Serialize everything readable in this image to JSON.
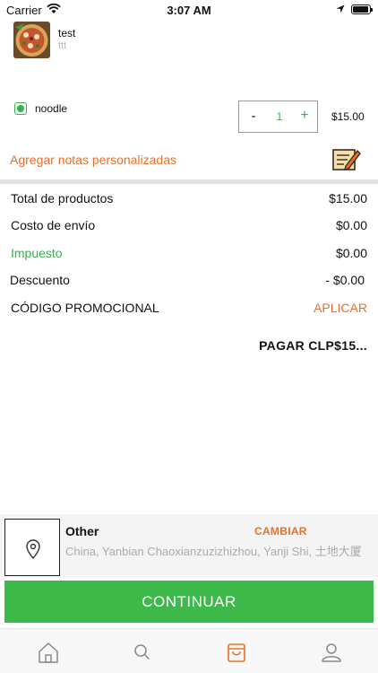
{
  "status_bar": {
    "carrier": "Carrier",
    "time": "3:07 AM"
  },
  "product": {
    "name": "test",
    "description": "ttt",
    "image_icon": "pizza-image"
  },
  "option": {
    "label": "noodle",
    "selected": true
  },
  "stepper": {
    "minus": "-",
    "value": "1",
    "plus": "+"
  },
  "line_price": "$15.00",
  "notes_link": "Agregar notas personalizadas",
  "summary": {
    "subtotal_label": "Total de productos",
    "subtotal_value": "$15.00",
    "shipping_label": "Costo de envío",
    "shipping_value": "$0.00",
    "tax_label": "Impuesto",
    "tax_value": "$0.00",
    "discount_label": "Descuento",
    "discount_value": "- $0.00",
    "promo_label": "CÓDIGO PROMOCIONAL",
    "promo_apply": "APLICAR"
  },
  "pay_label": "PAGAR  CLP$15...",
  "address": {
    "name": "Other",
    "change": "CAMBIAR",
    "text": "China, Yanbian Chaoxianzuzizhizhou, Yanji Shi, 土地大厦"
  },
  "continue_label": "CONTINUAR",
  "tabs": [
    "home-icon",
    "search-icon",
    "bag-icon",
    "profile-icon"
  ],
  "colors": {
    "accent_green": "#3db94a",
    "accent_orange": "#e8702a"
  }
}
